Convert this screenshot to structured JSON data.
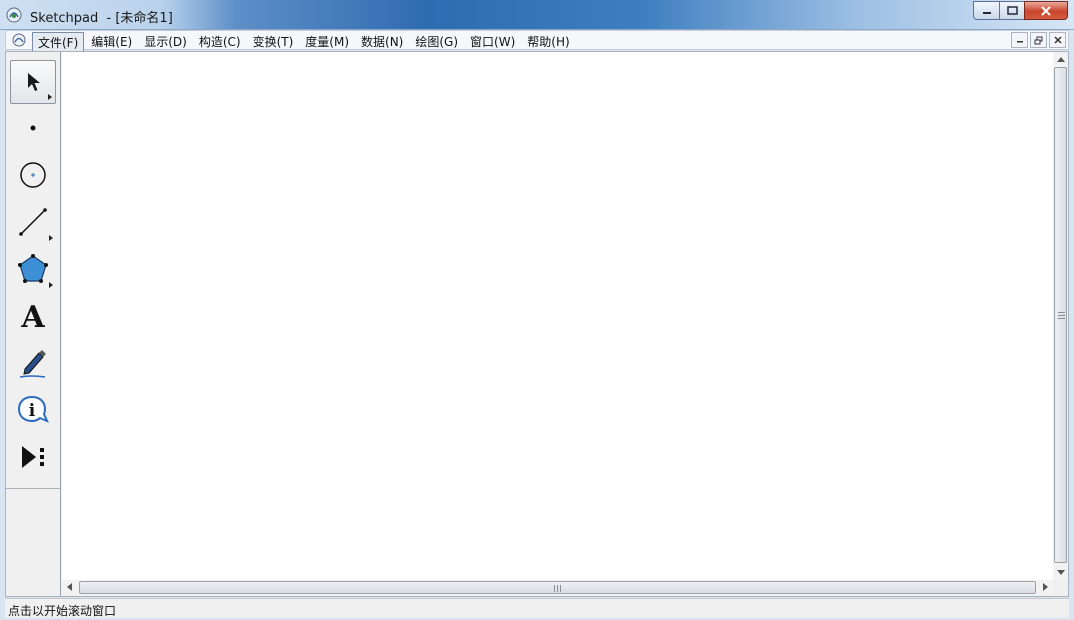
{
  "window": {
    "title": "Sketchpad  - [未命名1]"
  },
  "menu": {
    "items": [
      {
        "label": "文件(F)"
      },
      {
        "label": "编辑(E)"
      },
      {
        "label": "显示(D)"
      },
      {
        "label": "构造(C)"
      },
      {
        "label": "变换(T)"
      },
      {
        "label": "度量(M)"
      },
      {
        "label": "数据(N)"
      },
      {
        "label": "绘图(G)"
      },
      {
        "label": "窗口(W)"
      },
      {
        "label": "帮助(H)"
      }
    ],
    "active_index": 0
  },
  "toolbox": {
    "tools": [
      {
        "icon": "selection-arrow-icon",
        "selected": true
      },
      {
        "icon": "point-icon"
      },
      {
        "icon": "compass-circle-icon"
      },
      {
        "icon": "straightedge-icon"
      },
      {
        "icon": "polygon-icon"
      },
      {
        "icon": "text-icon",
        "glyph": "A"
      },
      {
        "icon": "marker-icon"
      },
      {
        "icon": "information-icon",
        "glyph": "i"
      },
      {
        "icon": "custom-tool-icon"
      }
    ]
  },
  "status": {
    "text": "点击以开始滚动窗口"
  },
  "colors": {
    "polygon_fill": "#3d8fd6",
    "canvas": "#ffffff",
    "close_button": "#c8462e"
  }
}
